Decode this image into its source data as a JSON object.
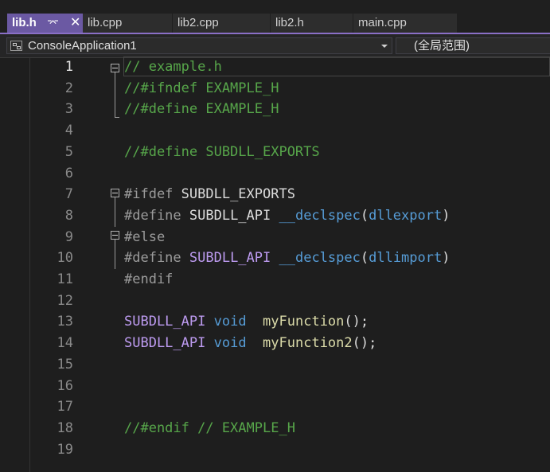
{
  "tabs": [
    {
      "label": "lib.h",
      "active": true,
      "pin_icon": "pin-icon",
      "close_icon": "close-icon"
    },
    {
      "label": "lib.cpp"
    },
    {
      "label": "lib2.cpp"
    },
    {
      "label": "lib2.h"
    },
    {
      "label": "main.cpp"
    }
  ],
  "navbar": {
    "project_scope": "ConsoleApplication1",
    "member_scope": "(全局范围)"
  },
  "colors": {
    "comment": "#57a64a",
    "keyword": "#569cd6",
    "preprocessor": "#9b9b9b",
    "macro": "#bd9bf0",
    "function": "#dcdcaa",
    "text": "#dcdcdc",
    "tab_active": "#6b59a3"
  },
  "editor": {
    "current_line": 1,
    "lines": [
      {
        "num": "1",
        "tokens": [
          {
            "t": "// example.h",
            "c": "comment"
          }
        ]
      },
      {
        "num": "2",
        "tokens": [
          {
            "t": "//#ifndef EXAMPLE_H",
            "c": "comment"
          }
        ]
      },
      {
        "num": "3",
        "tokens": [
          {
            "t": "//#define EXAMPLE_H",
            "c": "comment"
          }
        ]
      },
      {
        "num": "4",
        "tokens": []
      },
      {
        "num": "5",
        "tokens": [
          {
            "t": "//#define SUBDLL_EXPORTS",
            "c": "comment"
          }
        ]
      },
      {
        "num": "6",
        "tokens": []
      },
      {
        "num": "7",
        "tokens": [
          {
            "t": "#ifdef ",
            "c": "preprocessor"
          },
          {
            "t": "SUBDLL_EXPORTS",
            "c": "text"
          }
        ]
      },
      {
        "num": "8",
        "tokens": [
          {
            "t": "#define ",
            "c": "preprocessor"
          },
          {
            "t": "SUBDLL_API ",
            "c": "text"
          },
          {
            "t": "__declspec",
            "c": "keyword"
          },
          {
            "t": "(",
            "c": "text"
          },
          {
            "t": "dllexport",
            "c": "keyword"
          },
          {
            "t": ")",
            "c": "text"
          }
        ]
      },
      {
        "num": "9",
        "tokens": [
          {
            "t": "#else",
            "c": "preprocessor"
          }
        ]
      },
      {
        "num": "10",
        "tokens": [
          {
            "t": "#define ",
            "c": "preprocessor"
          },
          {
            "t": "SUBDLL_API",
            "c": "macro"
          },
          {
            "t": " ",
            "c": "text"
          },
          {
            "t": "__declspec",
            "c": "keyword"
          },
          {
            "t": "(",
            "c": "text"
          },
          {
            "t": "dllimport",
            "c": "keyword"
          },
          {
            "t": ")",
            "c": "text"
          }
        ]
      },
      {
        "num": "11",
        "tokens": [
          {
            "t": "#endif",
            "c": "preprocessor"
          }
        ]
      },
      {
        "num": "12",
        "tokens": []
      },
      {
        "num": "13",
        "tokens": [
          {
            "t": "SUBDLL_API",
            "c": "macro"
          },
          {
            "t": " ",
            "c": "text"
          },
          {
            "t": "void",
            "c": "keyword"
          },
          {
            "t": "  ",
            "c": "text"
          },
          {
            "t": "myFunction",
            "c": "function"
          },
          {
            "t": "();",
            "c": "text"
          }
        ]
      },
      {
        "num": "14",
        "tokens": [
          {
            "t": "SUBDLL_API",
            "c": "macro"
          },
          {
            "t": " ",
            "c": "text"
          },
          {
            "t": "void",
            "c": "keyword"
          },
          {
            "t": "  ",
            "c": "text"
          },
          {
            "t": "myFunction2",
            "c": "function"
          },
          {
            "t": "();",
            "c": "text"
          }
        ]
      },
      {
        "num": "15",
        "tokens": []
      },
      {
        "num": "16",
        "tokens": []
      },
      {
        "num": "17",
        "tokens": []
      },
      {
        "num": "18",
        "tokens": [
          {
            "t": "//#endif // EXAMPLE_H",
            "c": "comment"
          }
        ]
      },
      {
        "num": "19",
        "tokens": []
      }
    ]
  }
}
